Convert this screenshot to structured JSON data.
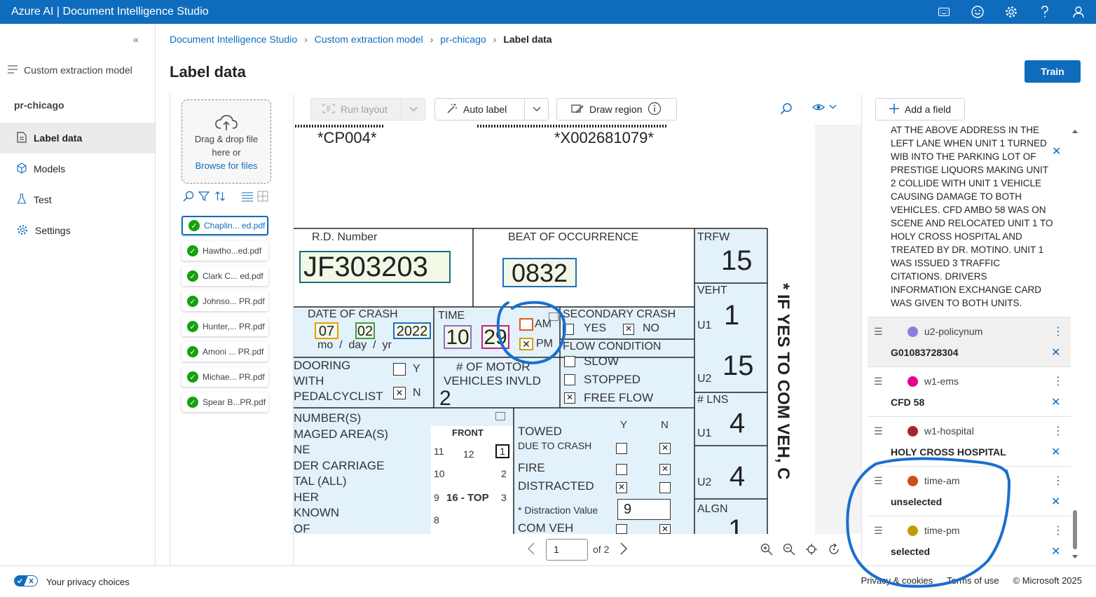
{
  "app": {
    "title": "Azure AI | Document Intelligence Studio"
  },
  "topbar_icons": [
    "keyboard-icon",
    "feedback-smiley-icon",
    "settings-gear-icon",
    "help-icon",
    "account-icon"
  ],
  "nav": {
    "collapse_label": "«",
    "model_type": "Custom extraction model",
    "project": "pr-chicago",
    "items": [
      {
        "label": "Label data",
        "icon": "document-icon",
        "active": true
      },
      {
        "label": "Models",
        "icon": "cube-icon",
        "active": false
      },
      {
        "label": "Test",
        "icon": "flask-icon",
        "active": false
      },
      {
        "label": "Settings",
        "icon": "gear-icon",
        "active": false
      }
    ]
  },
  "breadcrumb": {
    "items": [
      "Document Intelligence Studio",
      "Custom extraction model",
      "pr-chicago"
    ],
    "current": "Label data"
  },
  "page": {
    "title": "Label data",
    "train_label": "Train"
  },
  "upload": {
    "line1": "Drag & drop file",
    "line2": "here or",
    "browse": "Browse for files"
  },
  "files": [
    {
      "name": "Chaplin... ed.pdf",
      "selected": true
    },
    {
      "name": "Hawtho...ed.pdf",
      "selected": false
    },
    {
      "name": "Clark C... ed.pdf",
      "selected": false
    },
    {
      "name": "Johnso... PR.pdf",
      "selected": false
    },
    {
      "name": "Hunter,... PR.pdf",
      "selected": false
    },
    {
      "name": "Amoni ... PR.pdf",
      "selected": false
    },
    {
      "name": "Michae... PR.pdf",
      "selected": false
    },
    {
      "name": "Spear B...PR.pdf",
      "selected": false
    }
  ],
  "toolbar": {
    "run_layout": "Run layout",
    "auto_label": "Auto label",
    "draw_region": "Draw region"
  },
  "document": {
    "barcode_left": "*CP004*",
    "barcode_right": "*X002681079*",
    "rd_number_label": "R.D. Number",
    "rd_number": "JF303203",
    "beat_label": "BEAT OF OCCURRENCE",
    "beat": "0832",
    "trfw_label": "TRFW",
    "trfw": "15",
    "veht_label": "VEHT",
    "u1": "U1",
    "u2": "U2",
    "veht_u1": "1",
    "veht_u2": "15",
    "date_label": "DATE OF CRASH",
    "month": "07",
    "day": "02",
    "year": "2022",
    "date_hint": "mo  /  day  /  yr",
    "time_label": "TIME",
    "hour": "10",
    "minute": "29",
    "am": "AM",
    "pm": "PM",
    "secondary_label": "SECONDARY CRASH",
    "yes": "YES",
    "no": "NO",
    "flow_label": "FLOW CONDITION",
    "slow": "SLOW",
    "stopped": "STOPPED",
    "free_flow": "FREE FLOW",
    "dooring_1": "DOORING",
    "dooring_2": "WITH",
    "dooring_3": "PEDALCYCLIST",
    "y": "Y",
    "n": "N",
    "motor_label_1": "# OF MOTOR",
    "motor_label_2": "VEHICLES INVLD",
    "motor_count": "2",
    "lns_label": "# LNS",
    "lns_u1": "4",
    "lns_u2": "4",
    "align_label": "ALGN",
    "align_val": "1",
    "damage_lines": [
      "NUMBER(S)",
      "MAGED AREA(S)",
      "NE",
      "DER CARRIAGE",
      "TAL (ALL)",
      "HER",
      "KNOWN",
      "OF"
    ],
    "front_label": "FRONT",
    "diagram_nums": [
      "11",
      "12",
      "1",
      "10",
      "2",
      "9",
      "16 - TOP",
      "3",
      "8"
    ],
    "towed_1": "TOWED",
    "towed_2": "DUE TO CRASH",
    "fire": "FIRE",
    "distracted": "DISTRACTED",
    "distraction_value_label": "* Distraction Value",
    "distraction_value": "9",
    "com_veh": "COM VEH",
    "side_text": "* IF YES TO COM VEH, C"
  },
  "pager": {
    "page": "1",
    "of_label": "of 2"
  },
  "fields_panel": {
    "add_field": "Add a field",
    "narrative": "AT THE ABOVE ADDRESS IN THE LEFT LANE WHEN UNIT 1 TURNED WIB INTO THE PARKING LOT OF PRESTIGE LIQUORS MAKING UNIT 2 COLLIDE WITH UNIT 1 VEHICLE CAUSING DAMAGE TO BOTH VEHICLES. CFD AMBO 58 WAS ON SCENE AND RELOCATED UNIT 1 TO HOLY CROSS HOSPITAL AND TREATED BY DR. MOTINO. UNIT 1 WAS ISSUED 3 TRAFFIC CITATIONS. DRIVERS INFORMATION EXCHANGE CARD WAS GIVEN TO BOTH UNITS.",
    "fields": [
      {
        "name": "u2-policynum",
        "value": "G01083728304",
        "color": "#8a7fe0",
        "highlighted": true
      },
      {
        "name": "w1-ems",
        "value": "CFD 58",
        "color": "#e3008c",
        "highlighted": false
      },
      {
        "name": "w1-hospital",
        "value": "HOLY CROSS HOSPITAL",
        "color": "#a4262c",
        "highlighted": false
      },
      {
        "name": "time-am",
        "value": "unselected",
        "color": "#ca5010",
        "highlighted": false
      },
      {
        "name": "time-pm",
        "value": "selected",
        "color": "#c19c00",
        "highlighted": false
      }
    ]
  },
  "footer": {
    "privacy": "Your privacy choices",
    "privacy_cookies": "Privacy & cookies",
    "terms": "Terms of use",
    "copyright": "© Microsoft 2025"
  },
  "colors": {
    "brand": "#0f6cbd",
    "annotation": "#1a6fcf",
    "doc_blue_fill": "#e3f1fb"
  }
}
